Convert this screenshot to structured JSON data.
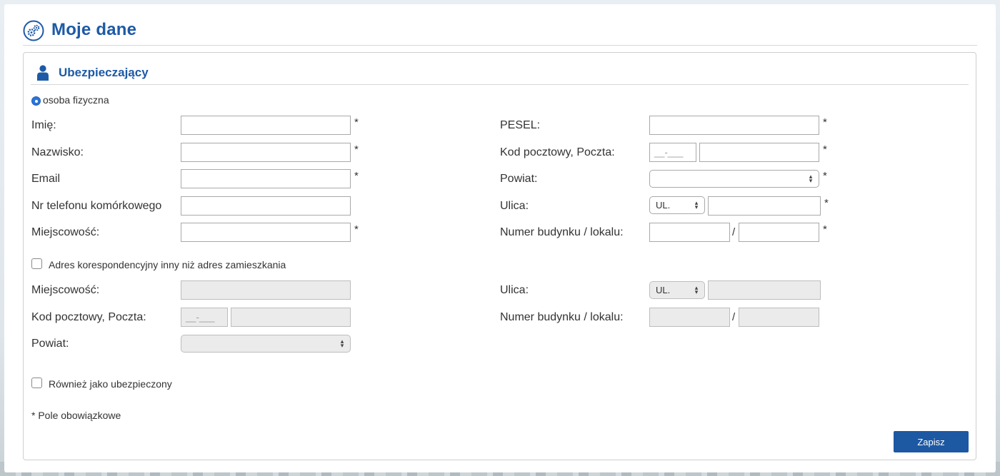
{
  "header": {
    "title": "Moje dane",
    "logo_icon": "gears-icon"
  },
  "section": {
    "title": "Ubezpieczający",
    "icon": "person-icon"
  },
  "person_type": {
    "label": "osoba fizyczna",
    "selected": true
  },
  "required_marker": "*",
  "left_fields": {
    "first_name": {
      "label": "Imię:"
    },
    "last_name": {
      "label": "Nazwisko:"
    },
    "email": {
      "label": "Email"
    },
    "phone": {
      "label": "Nr telefonu komórkowego"
    },
    "city": {
      "label": "Miejscowość:"
    }
  },
  "right_fields": {
    "pesel": {
      "label": "PESEL:"
    },
    "postal": {
      "label": "Kod pocztowy, Poczta:",
      "placeholder": "__-___"
    },
    "county": {
      "label": "Powiat:"
    },
    "street": {
      "label": "Ulica:",
      "prefix": "UL."
    },
    "building": {
      "label": "Numer budynku / lokalu:",
      "separator": "/"
    }
  },
  "correspondence": {
    "checkbox_label": "Adres korespondencyjny inny niż adres zamieszkania",
    "checked": false,
    "city": {
      "label": "Miejscowość:"
    },
    "postal": {
      "label": "Kod pocztowy, Poczta:",
      "placeholder": "__-___"
    },
    "county": {
      "label": "Powiat:"
    },
    "street": {
      "label": "Ulica:",
      "prefix": "UL."
    },
    "building": {
      "label": "Numer budynku / lokalu:",
      "separator": "/"
    }
  },
  "also_insured": {
    "label": "Również jako ubezpieczony",
    "checked": false
  },
  "required_note": "* Pole obowiązkowe",
  "submit": {
    "label": "Zapisz"
  },
  "colors": {
    "accent": "#1d5aa6",
    "button": "#1d58a3",
    "radio": "#2a75d9"
  }
}
